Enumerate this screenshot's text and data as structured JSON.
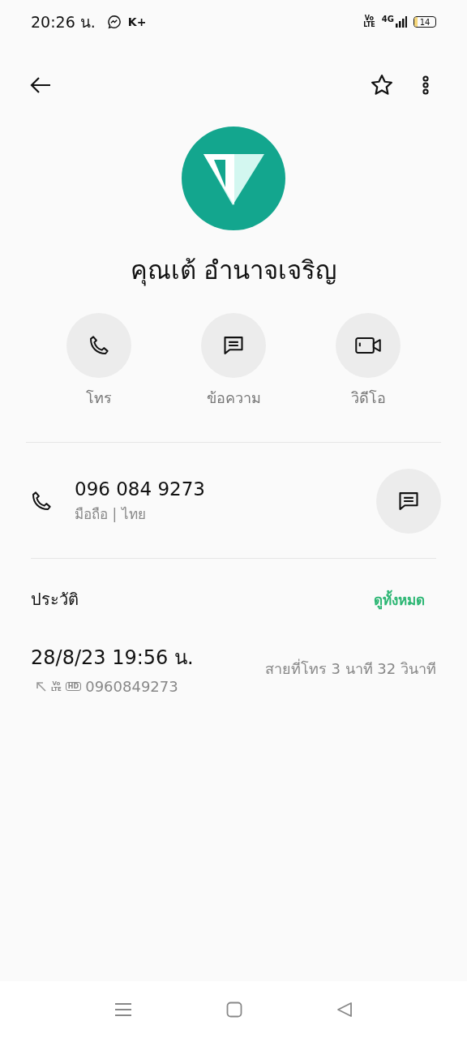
{
  "status_bar": {
    "time": "20:26 น.",
    "app_badge": "K+",
    "volte": [
      "Vo",
      "LTE"
    ],
    "network": "4G",
    "battery": "14"
  },
  "contact": {
    "name": "คุณเต้ อำนาจเจริญ",
    "favorite": false
  },
  "actions": [
    {
      "kind": "call",
      "label": "โทร"
    },
    {
      "kind": "message",
      "label": "ข้อความ"
    },
    {
      "kind": "video",
      "label": "วิดีโอ"
    }
  ],
  "phone": {
    "number": "096 084 9273",
    "detail": "มือถือ | ไทย"
  },
  "history": {
    "title": "ประวัติ",
    "view_all": "ดูทั้งหมด",
    "entries": [
      {
        "datetime": "28/8/23 19:56 น.",
        "badges": [
          "Vo",
          "LTE",
          "HD"
        ],
        "number": "0960849273",
        "duration": "สายที่โทร  3 นาที 32 วินาที"
      }
    ]
  }
}
